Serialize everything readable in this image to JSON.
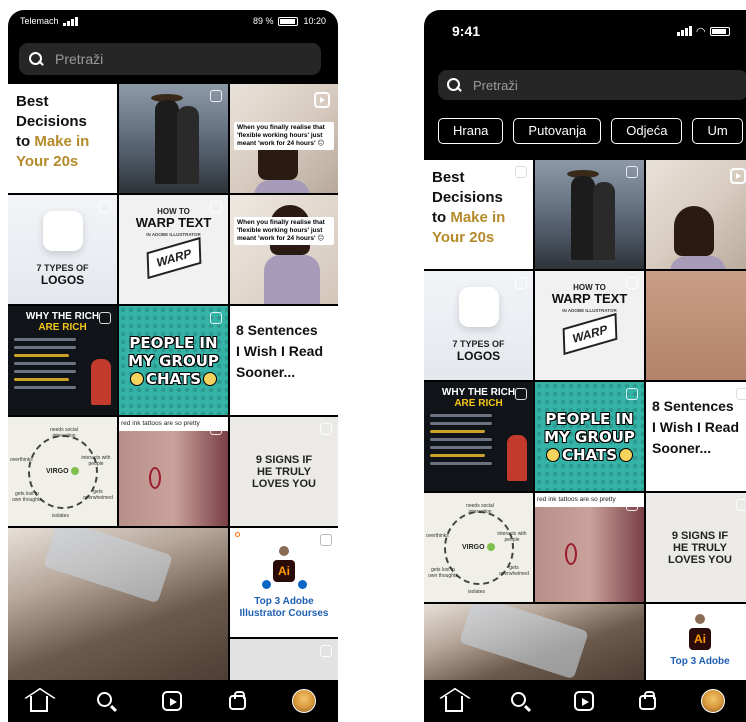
{
  "left_phone": {
    "status": {
      "carrier": "Telemach",
      "battery": "89 %",
      "time": "10:20"
    },
    "search": {
      "placeholder": "Pretraži"
    }
  },
  "right_phone": {
    "status": {
      "time": "9:41"
    },
    "search": {
      "placeholder": "Pretraži"
    },
    "chips": [
      "Hrana",
      "Putovanja",
      "Odjeća",
      "Um"
    ]
  },
  "tiles": {
    "best": {
      "line1": "Best",
      "line2": "Decisions",
      "line3a": "to ",
      "line3b": "Make in",
      "line4": "Your 20s"
    },
    "woman_caption": "When you finally realise that 'flexible working hours' just meant 'work for 24 hours' 😑",
    "woman_caption_short": "When you finally realise that 'flexible working hours' just meant 'work for 24 hours' 😑",
    "logos": {
      "line1": "7 TYPES OF",
      "line2": "LOGOS"
    },
    "warp": {
      "line1": "HOW TO",
      "line2": "WARP TEXT",
      "line3": "IN ADOBE ILLUSTRATOR",
      "box": "WARP"
    },
    "rich": {
      "line1": "WHY THE RICH",
      "line2": "ARE RICH"
    },
    "people": {
      "line1": "PEOPLE IN",
      "line2": "MY GROUP",
      "line3": "CHATS"
    },
    "sentences": {
      "line1": "8 Sentences",
      "line2": "I Wish I Read",
      "line3": "Sooner..."
    },
    "virgo": {
      "center": "VIRGO",
      "labels": [
        "needs social interaction",
        "overthinks",
        "interacts with people",
        "gets lost in own thoughts",
        "gets overwhelmed",
        "isolates"
      ]
    },
    "ink_header": "red ink tattoos are so pretty",
    "signs": {
      "line1": "9 SIGNS IF",
      "line2": "HE TRULY",
      "line3": "LOVES YOU"
    },
    "adobe": {
      "logo": "Ai",
      "line1": "Top 3 Adobe",
      "line2": "Illustrator Courses"
    }
  },
  "nav_icons": [
    "home-icon",
    "search-icon",
    "reels-icon",
    "shop-icon",
    "profile-avatar"
  ]
}
